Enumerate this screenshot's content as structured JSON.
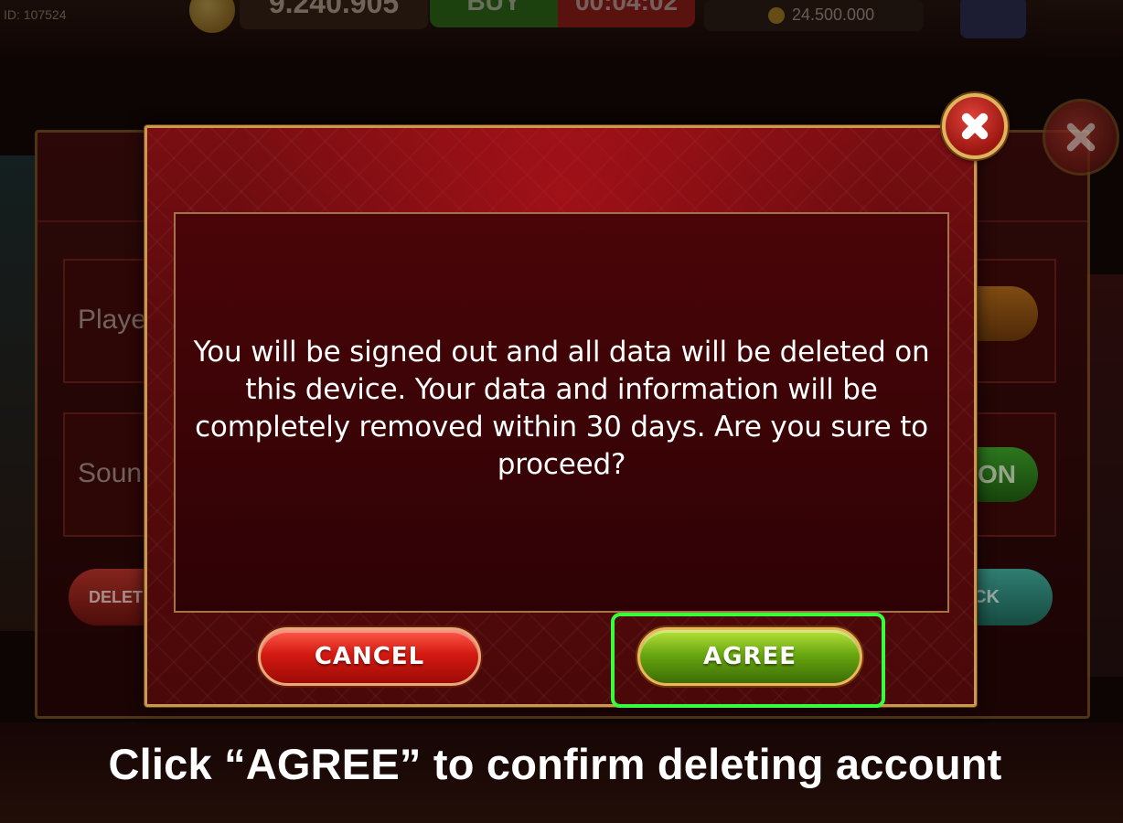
{
  "background": {
    "user_id": "ID: 107524",
    "coin_balance": "9.240.905",
    "buy_label": "BUY",
    "timer": "00:04:02",
    "jackpot": "24.500.000",
    "settings": {
      "player_label": "Playe",
      "sound_label": "Soun",
      "sound_toggle": "ON",
      "delete_label": "DELET",
      "back_label": "CK"
    }
  },
  "dialog": {
    "message": "You will be signed out and all data will be deleted on this device. Your data and information will be completely removed within 30 days. Are you sure to proceed?",
    "cancel_label": "CANCEL",
    "agree_label": "AGREE"
  },
  "caption": "Click “AGREE” to confirm deleting account",
  "colors": {
    "highlight": "#36ff3a",
    "agree": "#6aa811",
    "cancel": "#d41a12",
    "dialog_bg": "#5a0a0c",
    "border_gold": "#c79a4e"
  }
}
